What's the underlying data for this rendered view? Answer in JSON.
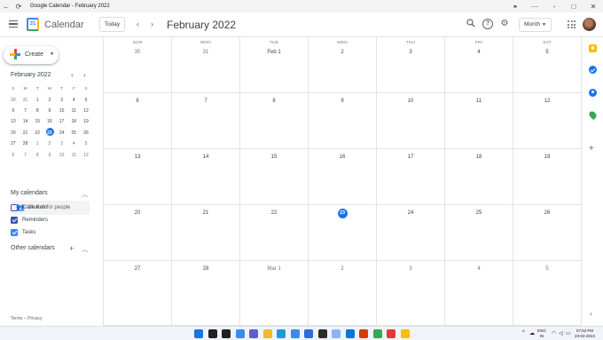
{
  "window": {
    "title": "Google Calendar - February 2022",
    "controls": [
      "-",
      "□",
      "✕"
    ]
  },
  "header": {
    "app_name": "Calendar",
    "logo_text": "31",
    "today_label": "Today",
    "prev_symbol": "‹",
    "next_symbol": "›",
    "month_title": "February 2022",
    "view_label": "Month",
    "icons": [
      "search-icon",
      "help-icon",
      "settings-icon",
      "apps-icon",
      "avatar"
    ]
  },
  "sidebar": {
    "create_label": "Create",
    "mini": {
      "title": "February 2022",
      "weekday_heads": [
        "S",
        "M",
        "T",
        "W",
        "T",
        "F",
        "S"
      ],
      "weeks": [
        [
          {
            "d": "30",
            "dim": true
          },
          {
            "d": "31",
            "dim": true
          },
          {
            "d": "1"
          },
          {
            "d": "2"
          },
          {
            "d": "3"
          },
          {
            "d": "4"
          },
          {
            "d": "5"
          }
        ],
        [
          {
            "d": "6"
          },
          {
            "d": "7"
          },
          {
            "d": "8"
          },
          {
            "d": "9"
          },
          {
            "d": "10"
          },
          {
            "d": "11"
          },
          {
            "d": "12"
          }
        ],
        [
          {
            "d": "13"
          },
          {
            "d": "14"
          },
          {
            "d": "15"
          },
          {
            "d": "16"
          },
          {
            "d": "17"
          },
          {
            "d": "18"
          },
          {
            "d": "19"
          }
        ],
        [
          {
            "d": "20"
          },
          {
            "d": "21"
          },
          {
            "d": "22"
          },
          {
            "d": "23",
            "sel": true
          },
          {
            "d": "24"
          },
          {
            "d": "25"
          },
          {
            "d": "26"
          }
        ],
        [
          {
            "d": "27"
          },
          {
            "d": "28"
          },
          {
            "d": "1",
            "dim": true
          },
          {
            "d": "2",
            "dim": true
          },
          {
            "d": "3",
            "dim": true
          },
          {
            "d": "4",
            "dim": true
          },
          {
            "d": "5",
            "dim": true
          }
        ],
        [
          {
            "d": "6",
            "dim": true
          },
          {
            "d": "7",
            "dim": true
          },
          {
            "d": "8",
            "dim": true
          },
          {
            "d": "9",
            "dim": true
          },
          {
            "d": "10",
            "dim": true
          },
          {
            "d": "11",
            "dim": true
          },
          {
            "d": "12",
            "dim": true
          }
        ]
      ]
    },
    "search_people_placeholder": "Search for people",
    "my_calendars_label": "My calendars",
    "calendars": [
      {
        "name": "Clark Kent",
        "checked": false
      },
      {
        "name": "Reminders",
        "checked": true
      },
      {
        "name": "Tasks",
        "checked": true
      }
    ],
    "other_calendars_label": "Other calendars",
    "terms_label": "Terms – Privacy"
  },
  "month_grid": {
    "weekday_heads": [
      "SUN",
      "MON",
      "TUE",
      "WED",
      "THU",
      "FRI",
      "SAT"
    ],
    "weeks": [
      [
        {
          "d": "30",
          "dim": true
        },
        {
          "d": "31",
          "dim": true
        },
        {
          "d": "Feb 1"
        },
        {
          "d": "2"
        },
        {
          "d": "3"
        },
        {
          "d": "4"
        },
        {
          "d": "5"
        }
      ],
      [
        {
          "d": "6"
        },
        {
          "d": "7"
        },
        {
          "d": "8"
        },
        {
          "d": "9"
        },
        {
          "d": "10"
        },
        {
          "d": "11"
        },
        {
          "d": "12"
        }
      ],
      [
        {
          "d": "13"
        },
        {
          "d": "14"
        },
        {
          "d": "15"
        },
        {
          "d": "16"
        },
        {
          "d": "17"
        },
        {
          "d": "18"
        },
        {
          "d": "19"
        }
      ],
      [
        {
          "d": "20"
        },
        {
          "d": "21"
        },
        {
          "d": "22"
        },
        {
          "d": "23",
          "today": true
        },
        {
          "d": "24"
        },
        {
          "d": "25"
        },
        {
          "d": "26"
        }
      ],
      [
        {
          "d": "27"
        },
        {
          "d": "28"
        },
        {
          "d": "Mar 1",
          "dim": true
        },
        {
          "d": "2",
          "dim": true
        },
        {
          "d": "3",
          "dim": true
        },
        {
          "d": "4",
          "dim": true
        },
        {
          "d": "5",
          "dim": true
        }
      ]
    ]
  },
  "right_rail": {
    "icons": [
      "keep-icon",
      "tasks-icon",
      "contacts-icon",
      "maps-icon",
      "add-icon"
    ]
  },
  "taskbar": {
    "lang_top": "ENG",
    "lang_bottom": "IN",
    "time": "07:53 PM",
    "date": "23-02-2022",
    "apps": [
      {
        "name": "windows-start-icon",
        "color": "#1a73e8"
      },
      {
        "name": "search-taskbar-icon",
        "color": "#202124"
      },
      {
        "name": "task-view-icon",
        "color": "#202124"
      },
      {
        "name": "widgets-icon",
        "color": "#3b8beb"
      },
      {
        "name": "teams-chat-icon",
        "color": "#5b5fc7"
      },
      {
        "name": "file-explorer-icon",
        "color": "#f3b92a"
      },
      {
        "name": "edge-icon",
        "color": "#1f9bd8"
      },
      {
        "name": "store-icon",
        "color": "#3b8beb"
      },
      {
        "name": "photos-icon",
        "color": "#2b6fd6"
      },
      {
        "name": "terminal-icon",
        "color": "#2d2d2d"
      },
      {
        "name": "notepad-icon",
        "color": "#8ab4f8"
      },
      {
        "name": "vscode-icon",
        "color": "#0078d4"
      },
      {
        "name": "office-icon",
        "color": "#d83b01"
      },
      {
        "name": "chrome-icon",
        "color": "#34a853"
      },
      {
        "name": "opera-icon",
        "color": "#e53935"
      },
      {
        "name": "notes-icon",
        "color": "#fbbc04"
      }
    ]
  }
}
